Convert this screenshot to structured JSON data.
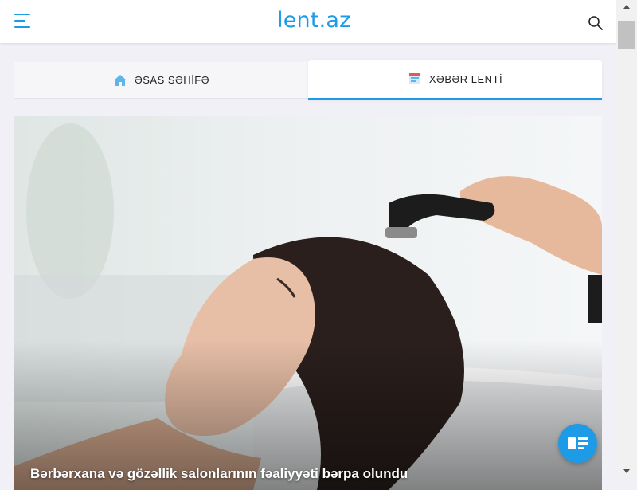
{
  "header": {
    "logo": "lent.az",
    "menu_icon": "hamburger-menu-icon",
    "search_icon": "search-icon"
  },
  "tabs": [
    {
      "label": "ƏSAS SƏHİFƏ",
      "icon": "home-icon",
      "active": false
    },
    {
      "label": "XƏBƏR LENTİ",
      "icon": "news-feed-icon",
      "active": true
    }
  ],
  "featured": {
    "title": "Bərbərxana və gözəllik salonlarının fəaliyyəti bərpa olundu"
  },
  "fab": {
    "icon": "news-list-icon"
  },
  "colors": {
    "accent": "#1e9be6",
    "background": "#f1f0f6"
  }
}
